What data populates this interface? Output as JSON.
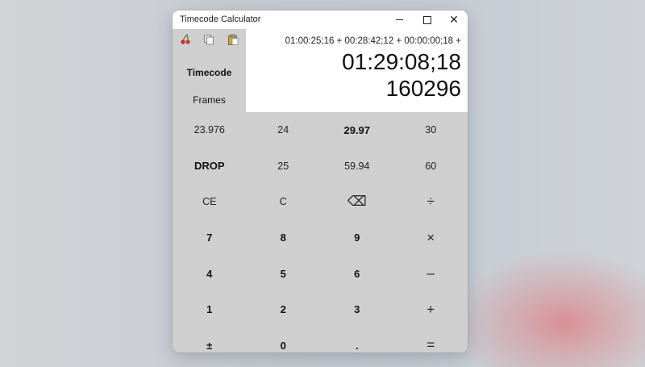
{
  "window": {
    "title": "Timecode Calculator",
    "controls": {
      "minimize": "minimize",
      "maximize": "maximize",
      "close": "✕"
    }
  },
  "toolbar": {
    "icons": [
      "cherry-icon",
      "copy-icon",
      "paste-icon"
    ]
  },
  "modes": {
    "timecode_label": "Timecode",
    "frames_label": "Frames",
    "selected": "Timecode"
  },
  "display": {
    "expression": "01:00:25;16 + 00:28:42;12 + 00:00:00;18 +",
    "timecode_result": "01:29:08;18",
    "frames_result": "160296"
  },
  "keypad": {
    "rows": [
      [
        "23.976",
        "24",
        "29.97",
        "30"
      ],
      [
        "DROP",
        "25",
        "59.94",
        "60"
      ],
      [
        "CE",
        "C",
        "⌫",
        "÷"
      ],
      [
        "7",
        "8",
        "9",
        "×"
      ],
      [
        "4",
        "5",
        "6",
        "–"
      ],
      [
        "1",
        "2",
        "3",
        "+"
      ],
      [
        "±",
        "0",
        ".",
        "="
      ]
    ]
  },
  "colors": {
    "panel": "#cfcfcf",
    "display_bg": "#ffffff",
    "titlebar": "#ffffff"
  }
}
